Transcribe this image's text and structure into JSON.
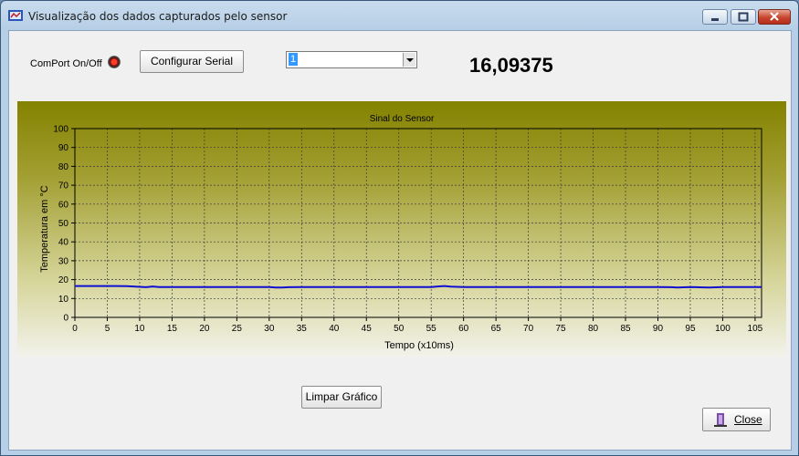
{
  "window": {
    "title": "Visualização dos dados capturados pelo sensor"
  },
  "controls": {
    "comport_label": "ComPort On/Off",
    "config_button": "Configurar Serial",
    "combo_value": "1",
    "reading": "16,09375",
    "clear_button": "Limpar Gráfico",
    "close_button": "Close"
  },
  "chart_data": {
    "type": "line",
    "title": "Sinal do Sensor",
    "xlabel": "Tempo (x10ms)",
    "ylabel": "Temperatura em °C",
    "xlim": [
      0,
      106
    ],
    "ylim": [
      0,
      100
    ],
    "xticks": [
      0,
      5,
      10,
      15,
      20,
      25,
      30,
      35,
      40,
      45,
      50,
      55,
      60,
      65,
      70,
      75,
      80,
      85,
      90,
      95,
      100,
      105
    ],
    "yticks": [
      0,
      10,
      20,
      30,
      40,
      50,
      60,
      70,
      80,
      90,
      100
    ],
    "grid": true,
    "series": [
      {
        "color": "#1010d0",
        "x": [
          0,
          2,
          4,
          6,
          8,
          10,
          11,
          12,
          13,
          15,
          20,
          25,
          30,
          31,
          32,
          33,
          35,
          40,
          45,
          50,
          55,
          56,
          57,
          58,
          60,
          65,
          70,
          75,
          80,
          85,
          90,
          92,
          93,
          95,
          97,
          98,
          100,
          105,
          106
        ],
        "values": [
          16.6,
          16.6,
          16.6,
          16.6,
          16.5,
          16.2,
          16.0,
          16.4,
          16.1,
          16.1,
          16.1,
          16.1,
          16.1,
          15.8,
          15.8,
          16.0,
          16.1,
          16.1,
          16.1,
          16.1,
          16.1,
          16.4,
          16.6,
          16.3,
          16.1,
          16.1,
          16.1,
          16.1,
          16.1,
          16.1,
          16.1,
          16.0,
          15.8,
          16.1,
          15.9,
          15.8,
          16.1,
          16.1,
          16.1
        ]
      }
    ]
  },
  "colors": {
    "line": "#1010d0",
    "panel_top": "#848200",
    "panel_bottom": "#f2f2ea"
  },
  "icons": {
    "app": "chart-app-icon",
    "close": "exit-door-icon",
    "status": "red-led-icon"
  }
}
